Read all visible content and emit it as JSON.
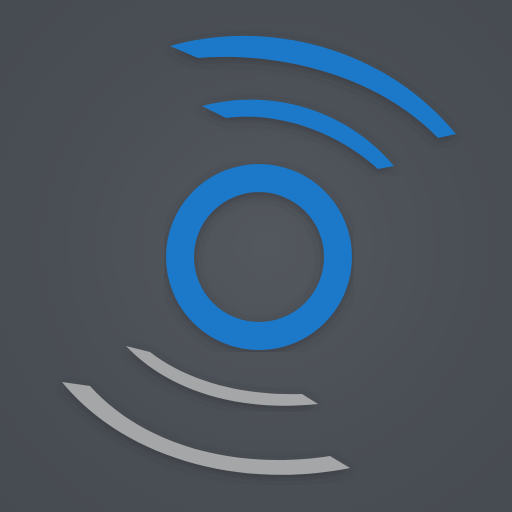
{
  "icon": {
    "name": "wireless-signal-logo",
    "colors": {
      "background": "#4a4f55",
      "accent_blue": "#1a78c8",
      "muted_gray": "#a4a6a8"
    },
    "elements": [
      {
        "name": "center-ring-icon",
        "color": "accent_blue"
      },
      {
        "name": "upper-inner-arc-icon",
        "color": "accent_blue"
      },
      {
        "name": "upper-outer-arc-icon",
        "color": "accent_blue"
      },
      {
        "name": "lower-inner-arc-icon",
        "color": "muted_gray"
      },
      {
        "name": "lower-outer-arc-icon",
        "color": "muted_gray"
      }
    ]
  }
}
